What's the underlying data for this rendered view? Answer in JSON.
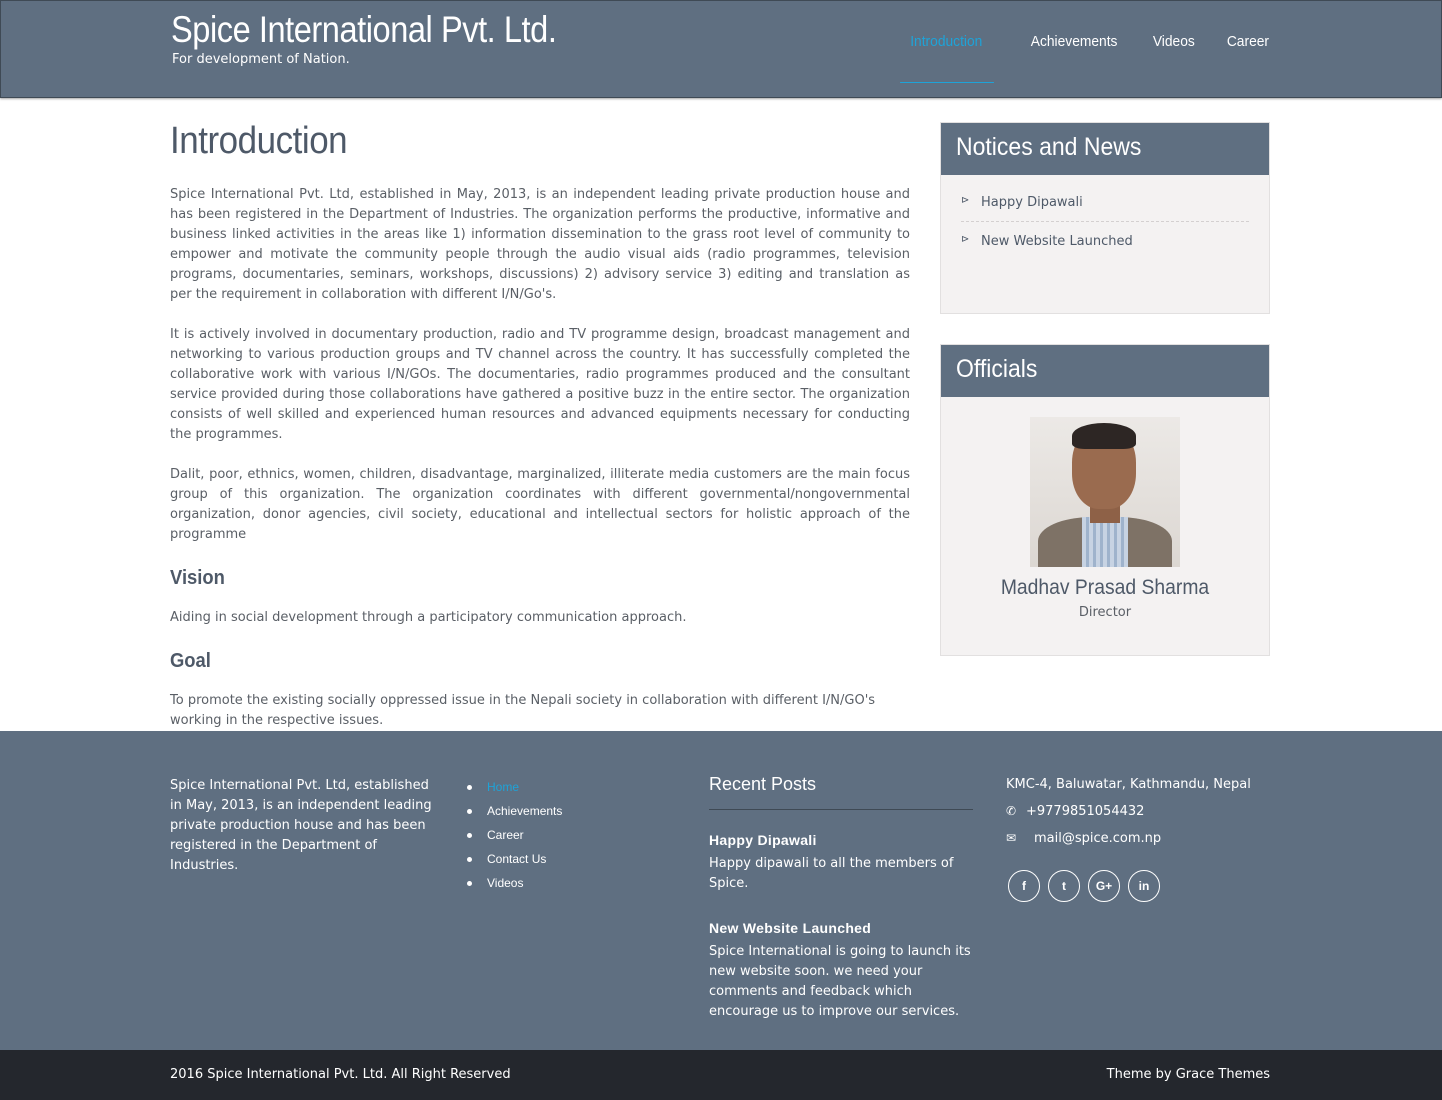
{
  "header": {
    "site_title": "Spice International Pvt. Ltd.",
    "tagline": "For development of Nation.",
    "nav": [
      "Introduction",
      "Achievements",
      "Videos",
      "Career"
    ],
    "active_nav": "Introduction"
  },
  "main": {
    "title": "Introduction",
    "paragraphs": [
      "Spice International Pvt. Ltd, established in May, 2013, is an independent leading private production house and has been registered in the Department of Industries. The organization performs the productive, informative and business linked activities in the areas like 1) information dissemination to the grass root level of community to empower and motivate the community people through the audio visual aids (radio programmes, television programs, documentaries, seminars, workshops, discussions) 2) advisory service 3) editing and translation as per the requirement in collaboration with different I/N/Go's.",
      "It is actively involved in documentary production, radio and TV programme design, broadcast management and networking to various production groups and TV channel across the country. It has successfully completed the collaborative work with various I/N/GOs. The documentaries, radio programmes produced and the consultant service provided during those collaborations have gathered a positive buzz in the entire sector. The organization consists of well skilled and experienced human resources and advanced equipments necessary for conducting the programmes.",
      "Dalit, poor, ethnics, women, children, disadvantage, marginalized, illiterate media customers are the main focus group of this organization. The organization coordinates with different governmental/nongovernmental organization, donor agencies, civil society, educational and intellectual sectors for holistic approach of the programme"
    ],
    "vision_heading": "Vision",
    "vision_text": "Aiding in social development through a participatory communication approach.",
    "goal_heading": "Goal",
    "goal_text": "To promote the existing socially oppressed issue in the Nepali society in collaboration with different I/N/GO's working in the respective issues."
  },
  "sidebar": {
    "news_title": "Notices and News",
    "news_items": [
      "Happy Dipawali",
      "New Website Launched"
    ],
    "officials_title": "Officials",
    "official_name": "Madhav Prasad Sharma",
    "official_role": "Director"
  },
  "footer": {
    "about": "Spice International Pvt. Ltd, established in May, 2013, is an independent leading private production house and has been registered in the Department of Industries.",
    "links": [
      "Home",
      "Achievements",
      "Career",
      "Contact Us",
      "Videos"
    ],
    "active_link": "Home",
    "recent_posts_title": "Recent Posts",
    "posts": [
      {
        "title": "Happy Dipawali",
        "text": "Happy dipawali to all the members of Spice."
      },
      {
        "title": "New Website Launched",
        "text": "Spice International is going to launch its new website soon. we need your comments and feedback which encourage us to improve our services."
      }
    ],
    "address": "KMC-4, Baluwatar, Kathmandu, Nepal",
    "phone": "+9779851054432",
    "email": "mail@spice.com.np",
    "social_icons": [
      "facebook-icon",
      "twitter-icon",
      "google-plus-icon",
      "linkedin-icon"
    ]
  },
  "bottom": {
    "copyright": "2016 Spice International Pvt. Ltd. All Right Reserved",
    "theme_credit": "Theme by Grace Themes"
  },
  "colors": {
    "header_bg": "#5f6f81",
    "accent": "#1ea3d8",
    "bottom_bar": "#24272d"
  }
}
